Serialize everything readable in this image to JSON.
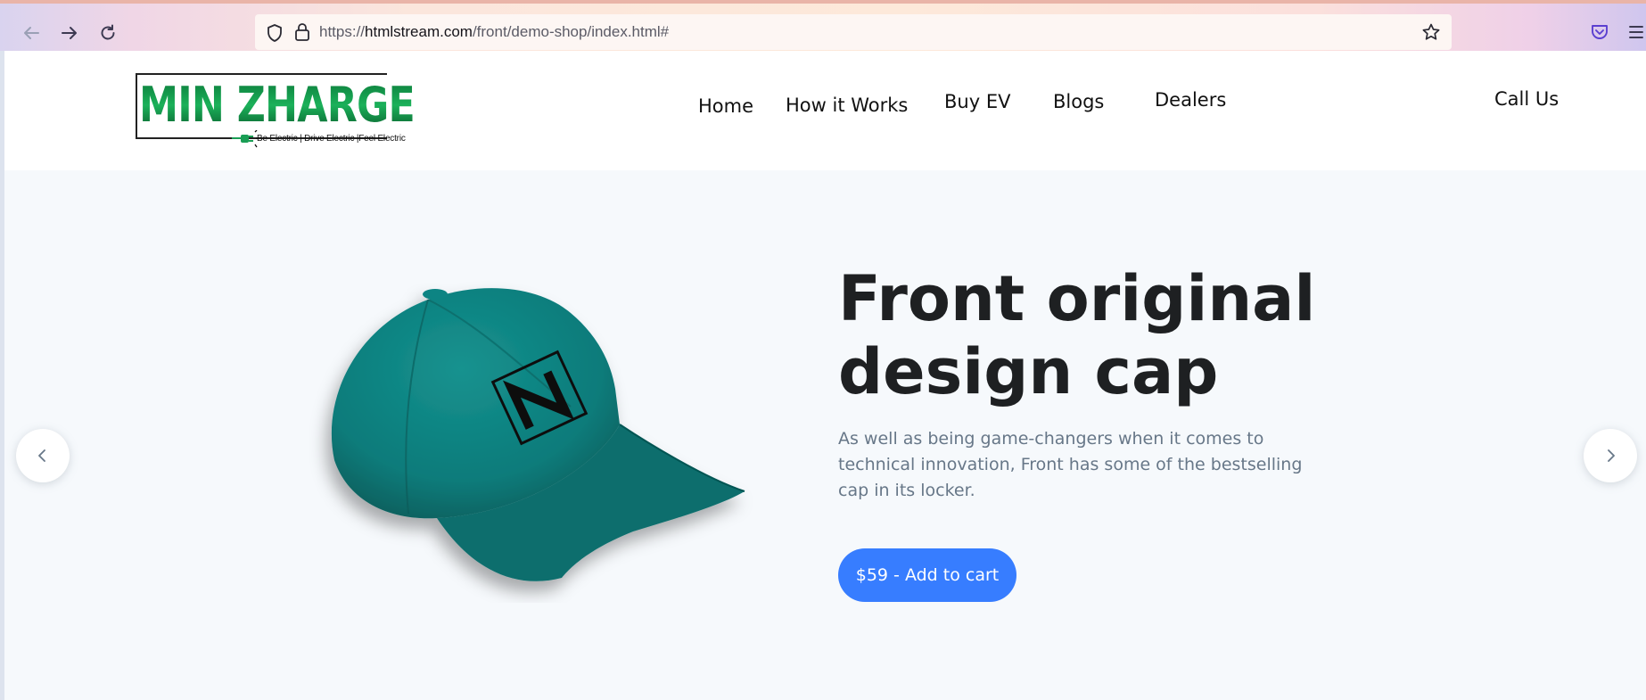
{
  "browser": {
    "url_prefix": "https://",
    "url_domain": "htmlstream.com",
    "url_path": "/front/demo-shop/index.html#"
  },
  "logo": {
    "name": "MIN ZHARGE",
    "tagline": "Be Electric | Drive Electric |Feel Electric"
  },
  "nav": {
    "home": "Home",
    "how_it_works": "How it Works",
    "buy_ev": "Buy EV",
    "blogs": "Blogs",
    "dealers": "Dealers",
    "call_us": "Call Us"
  },
  "hero": {
    "title_line1": "Front original",
    "title_line2": "design cap",
    "description": "As well as being game-changers when it comes to technical innovation, Front has some of the bestselling cap in its locker.",
    "cart_button": "$59 - Add to cart"
  },
  "colors": {
    "accent": "#377dff",
    "cap": "#0b7b7a",
    "title": "#1e2022",
    "text_muted": "#677788",
    "hero_bg": "#f6f9fc"
  },
  "icons": [
    "back-arrow-icon",
    "forward-arrow-icon",
    "reload-icon",
    "shield-icon",
    "lock-icon",
    "star-icon",
    "pocket-icon",
    "menu-icon",
    "chevron-left-icon",
    "chevron-right-icon"
  ]
}
